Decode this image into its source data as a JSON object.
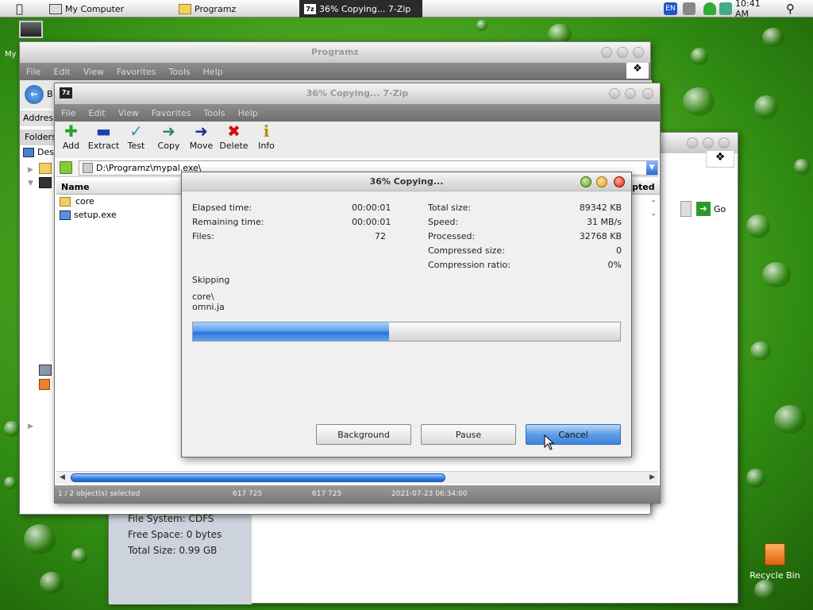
{
  "taskbar": {
    "items": [
      "My Computer",
      "Programz",
      "36% Copying... 7-Zip"
    ],
    "lang": "EN",
    "clock": "10:41 AM"
  },
  "desktop": {
    "mycomputer_label": "My",
    "recycle_label": "Recycle Bin"
  },
  "explorer_back": {
    "info": [
      "File System: CDFS",
      "Free Space: 0 bytes",
      "Total Size: 0.99 GB"
    ],
    "go_label": "Go"
  },
  "explorer_main": {
    "title": "Programz",
    "menu": [
      "File",
      "Edit",
      "View",
      "Favorites",
      "Tools",
      "Help"
    ],
    "back_label": "B",
    "address_label": "Address",
    "folders_label": "Folders",
    "tree_desktop": "Des"
  },
  "zip": {
    "title": "36% Copying... 7-Zip",
    "menu": [
      "File",
      "Edit",
      "View",
      "Favorites",
      "Tools",
      "Help"
    ],
    "toolbar": [
      "Add",
      "Extract",
      "Test",
      "Copy",
      "Move",
      "Delete",
      "Info"
    ],
    "path": "D:\\Programz\\mypal.exe\\",
    "col_name": "Name",
    "col_encrypted": "ypted",
    "files": [
      "core",
      "setup.exe"
    ],
    "enc_values": [
      "-",
      "-"
    ],
    "status": [
      "1 / 2 object(s) selected",
      "617 725",
      "617 725",
      "2021-07-23 06:34:00"
    ]
  },
  "dialog": {
    "title": "36% Copying...",
    "elapsed_label": "Elapsed time:",
    "elapsed": "00:00:01",
    "remaining_label": "Remaining time:",
    "remaining": "00:00:01",
    "files_label": "Files:",
    "files": "72",
    "total_label": "Total size:",
    "total": "89342 KB",
    "speed_label": "Speed:",
    "speed": "31 MB/s",
    "processed_label": "Processed:",
    "processed": "32768 KB",
    "csize_label": "Compressed size:",
    "csize": "0",
    "cratio_label": "Compression ratio:",
    "cratio": "0%",
    "action": "Skipping",
    "path1": "core\\",
    "path2": "omni.ja",
    "progress": 0.46,
    "background_label": "Background",
    "pause_label": "Pause",
    "cancel_label": "Cancel"
  },
  "colors": {
    "accent": "#3f84d8",
    "menubar": "#7a7a7a",
    "desktop": "#3a9a18"
  }
}
